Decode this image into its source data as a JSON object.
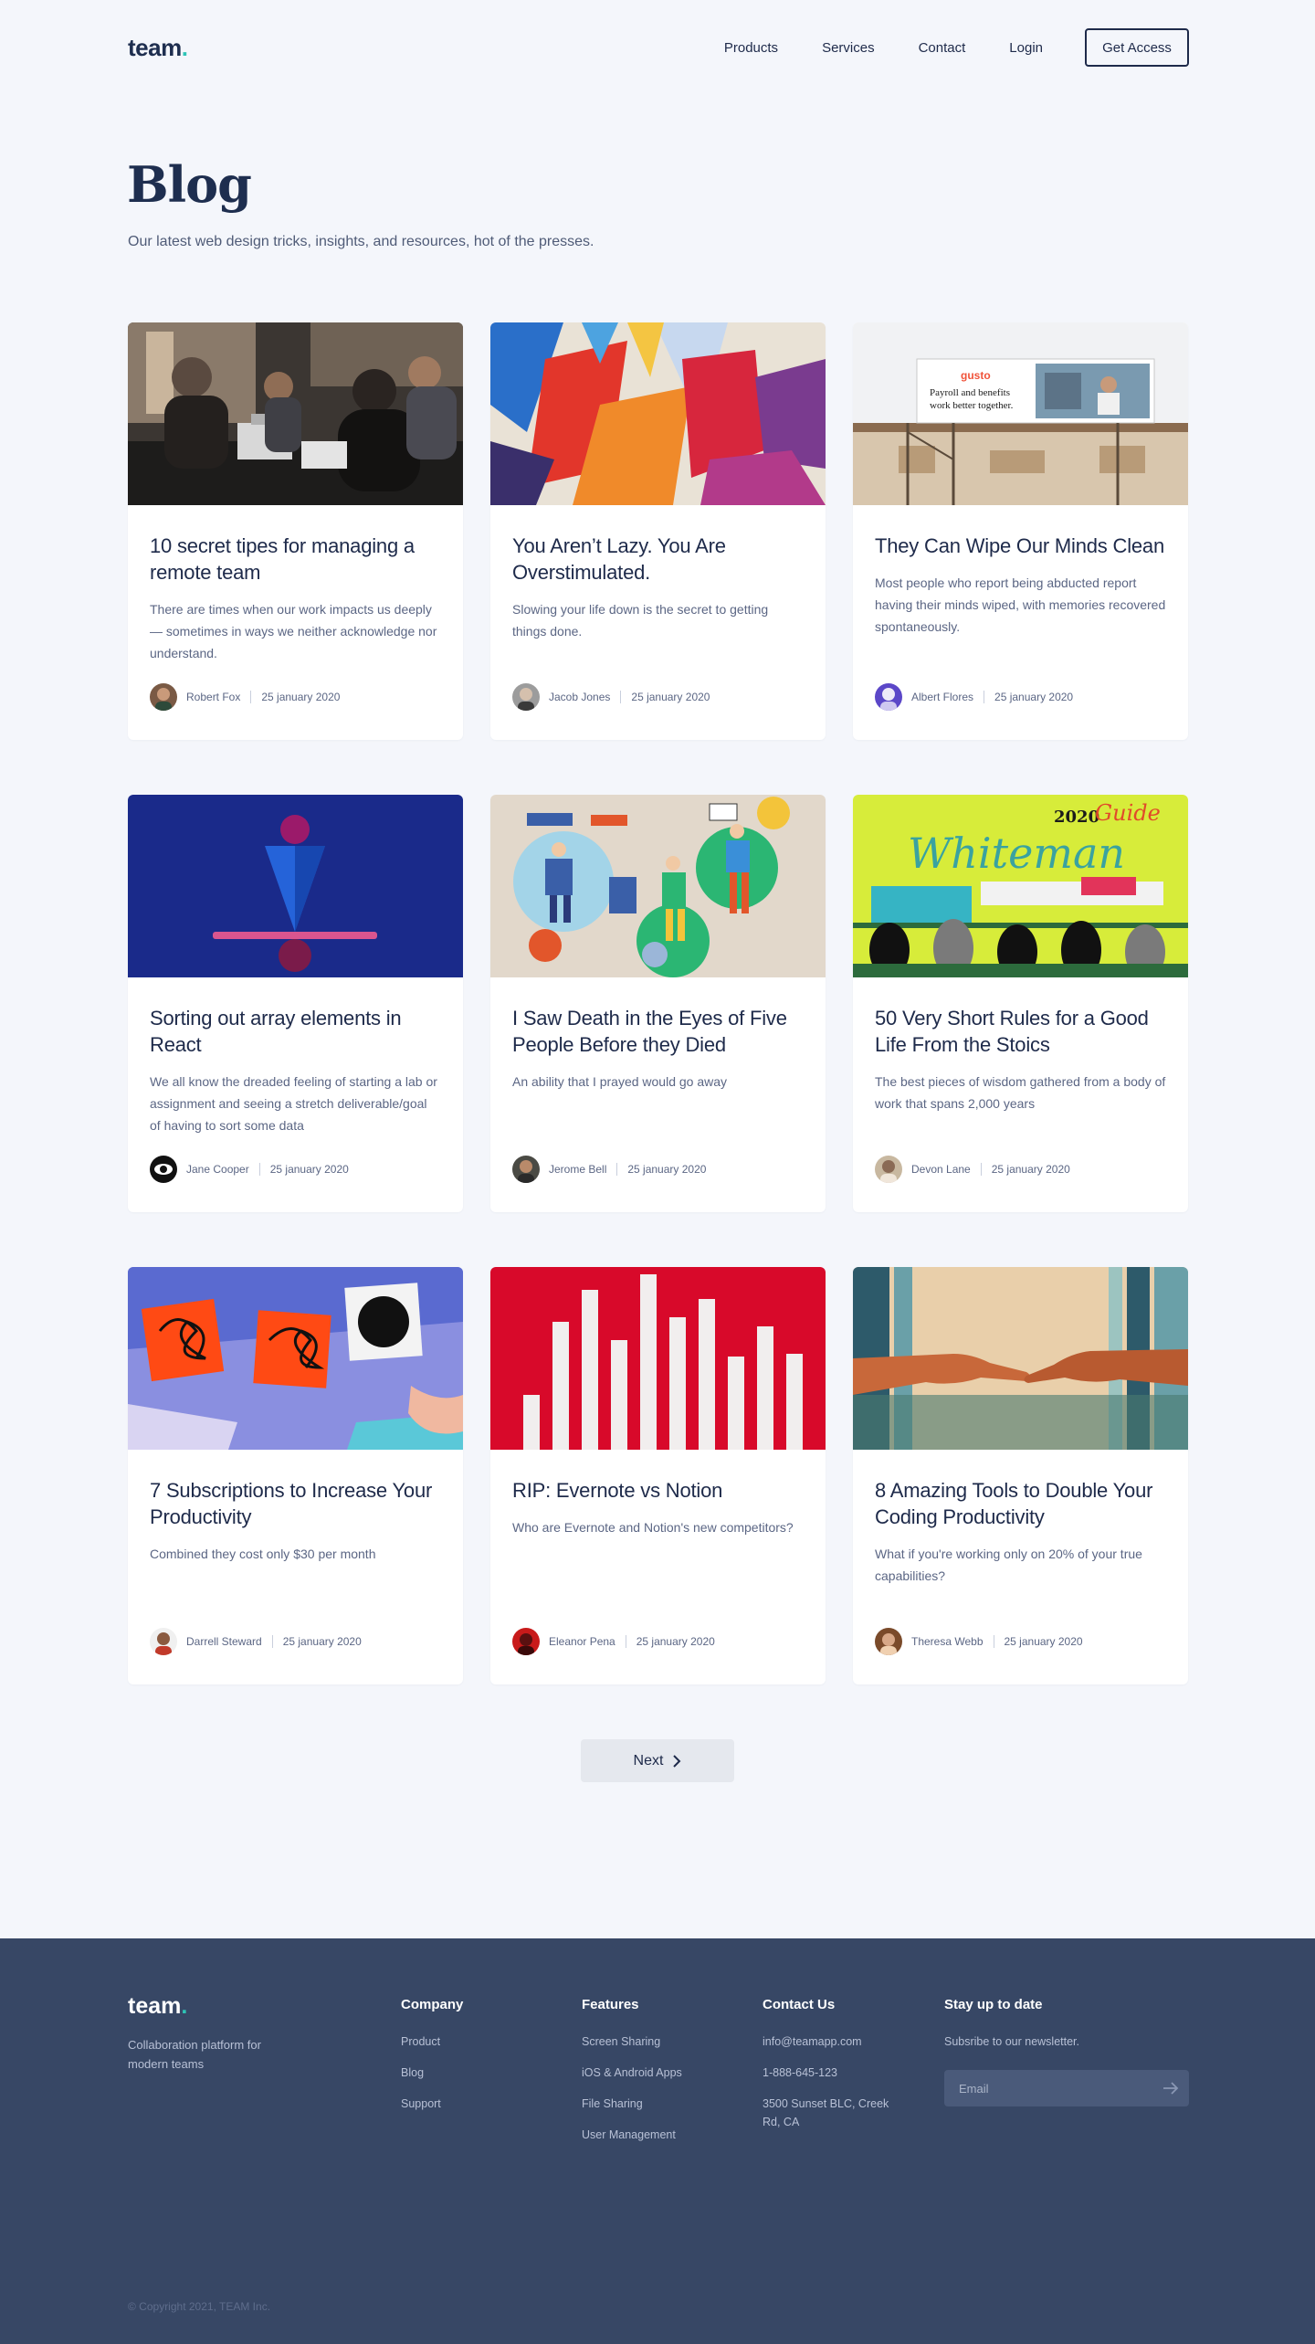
{
  "header": {
    "logo": "team",
    "logo_dot": ".",
    "nav": [
      "Products",
      "Services",
      "Contact",
      "Login"
    ],
    "cta": "Get Access"
  },
  "hero": {
    "title": "Blog",
    "subtitle": "Our latest web design tricks, insights, and resources, hot of the presses."
  },
  "posts": [
    {
      "title": "10 secret tipes for managing a remote team",
      "excerpt": "There are times when our work impacts us deeply — sometimes in ways we neither acknowledge nor understand.",
      "author": "Robert Fox",
      "date": "25 january 2020",
      "image": "team-meeting-photo"
    },
    {
      "title": "You Aren’t Lazy. You Are Overstimulated.",
      "excerpt": "Slowing your life down is the secret to getting things done.",
      "author": "Jacob Jones",
      "date": "25 january 2020",
      "image": "abstract-paint-art"
    },
    {
      "title": "They Can Wipe Our Minds Clean",
      "excerpt": "Most people who report being abducted report having their minds wiped, with memories recovered spontaneously.",
      "author": "Albert Flores",
      "date": "25 january 2020",
      "image": "billboard-photo"
    },
    {
      "title": "Sorting out array elements in React",
      "excerpt": "We all know the dreaded feeling of starting a lab or assignment and seeing a stretch deliverable/goal of having to sort some data",
      "author": "Jane Cooper",
      "date": "25 january 2020",
      "image": "balance-3d-render"
    },
    {
      "title": "I Saw Death in the Eyes of Five People Before they Died",
      "excerpt": "An ability that I prayed would go away",
      "author": "Jerome Bell",
      "date": "25 january 2020",
      "image": "people-illustration"
    },
    {
      "title": "50 Very Short Rules for a Good Life From the Stoics",
      "excerpt": "The best pieces of wisdom gathered from a body of work that spans 2,000 years",
      "author": "Devon Lane",
      "date": "25 january 2020",
      "image": "whiteman-guide-illustration"
    },
    {
      "title": "7 Subscriptions to Increase Your Productivity",
      "excerpt": "Combined they cost only $30 per month",
      "author": "Darrell Steward",
      "date": "25 january 2020",
      "image": "scribble-cards-illustration"
    },
    {
      "title": "RIP: Evernote vs Notion",
      "excerpt": "Who are Evernote and Notion's new competitors?",
      "author": "Eleanor Pena",
      "date": "25 january 2020",
      "image": "receipt-bars-red"
    },
    {
      "title": "8 Amazing Tools to Double Your Coding Productivity",
      "excerpt": "What if you're working only on 20% of your true capabilities?",
      "author": "Theresa Webb",
      "date": "25 january 2020",
      "image": "reaching-hands"
    }
  ],
  "thumb_text": {
    "billboard_brand": "gusto",
    "billboard_line1": "Payroll and benefits",
    "billboard_line2": "work better together.",
    "guide_year": "2020",
    "guide_script": "Guide",
    "guide_word": "Whiteman"
  },
  "pagination": {
    "next": "Next"
  },
  "footer": {
    "logo": "team",
    "logo_dot": ".",
    "tagline": "Collaboration platform for modern teams",
    "company": {
      "heading": "Company",
      "links": [
        "Product",
        "Blog",
        "Support"
      ]
    },
    "features": {
      "heading": "Features",
      "links": [
        "Screen Sharing",
        "iOS & Android Apps",
        "File Sharing",
        "User Management"
      ]
    },
    "contact": {
      "heading": "Contact Us",
      "email": "info@teamapp.com",
      "phone": "1-888-645-123",
      "address": "3500 Sunset BLC, Creek Rd, CA"
    },
    "newsletter": {
      "heading": "Stay up to date",
      "text": "Subsribe to our newsletter.",
      "placeholder": "Email"
    },
    "copyright": "© Copyright 2021, TEAM Inc."
  }
}
